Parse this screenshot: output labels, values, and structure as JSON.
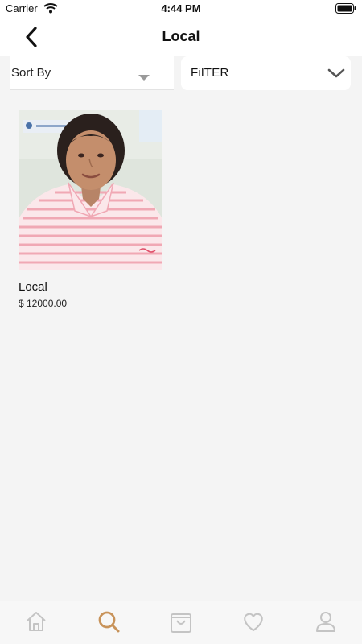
{
  "status_bar": {
    "carrier": "Carrier",
    "time": "4:44 PM"
  },
  "nav": {
    "title": "Local",
    "back_icon": "chevron-left-icon"
  },
  "toolbar": {
    "sort_label": "Sort By",
    "filter_label": "FilTER"
  },
  "products": [
    {
      "name": "Local",
      "price": "$ 12000.00"
    }
  ],
  "tab_bar": {
    "items": [
      "home-icon",
      "search-icon",
      "bag-icon",
      "heart-icon",
      "profile-icon"
    ],
    "active_index": 1,
    "active_color": "#c8935a",
    "inactive_color": "#c4c4c4"
  }
}
